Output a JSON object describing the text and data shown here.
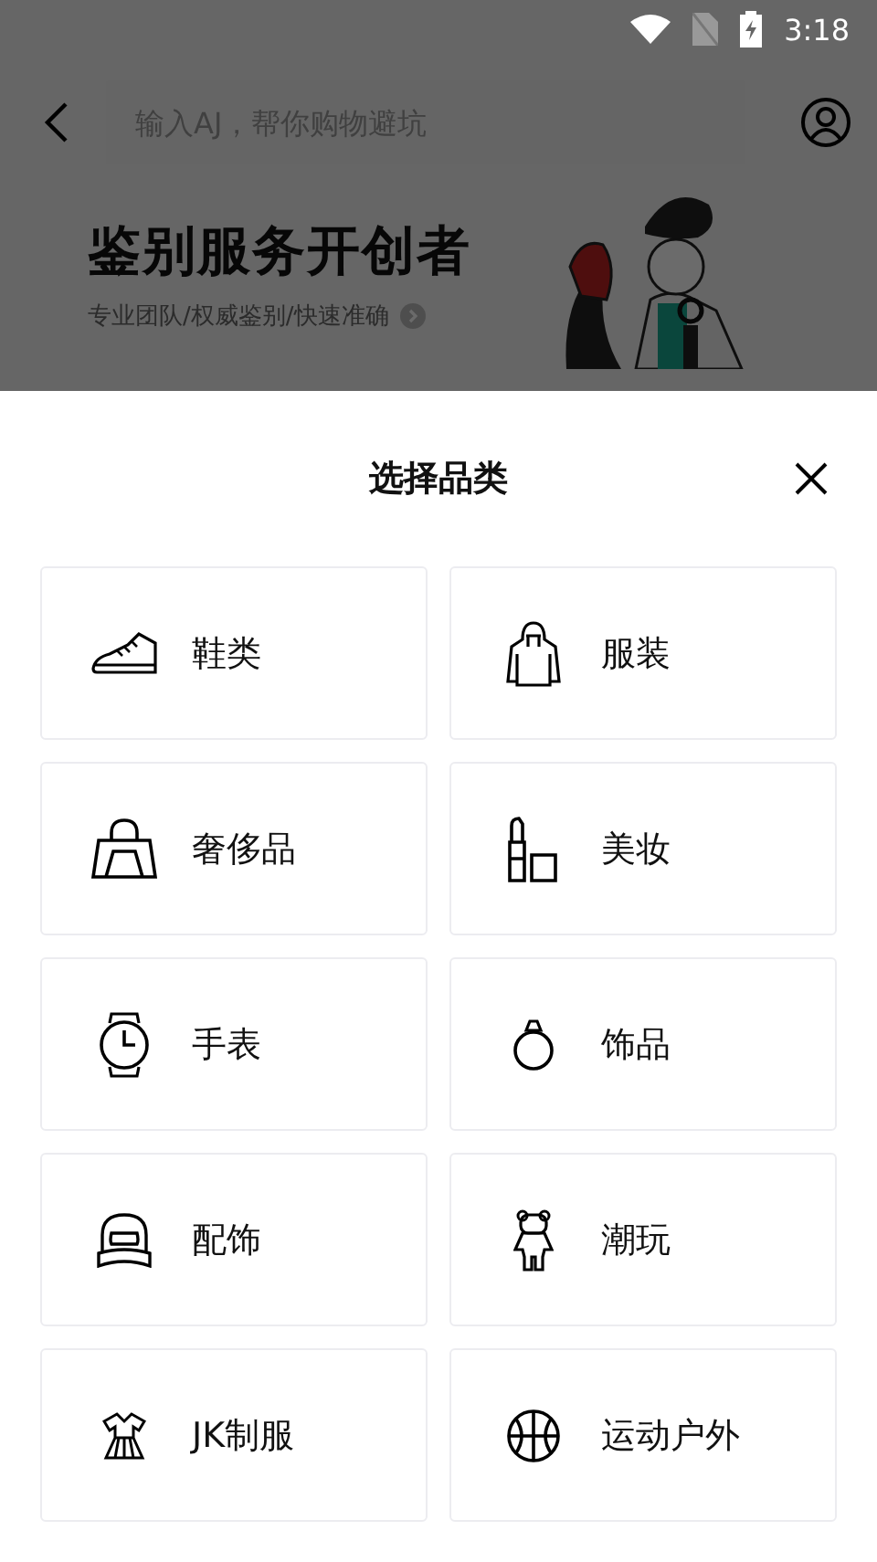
{
  "status_bar": {
    "time": "3:18"
  },
  "search": {
    "placeholder": "输入AJ，帮你购物避坑"
  },
  "banner": {
    "title": "鉴别服务开创者",
    "subtitle": "专业团队/权威鉴别/快速准确"
  },
  "sheet": {
    "title": "选择品类"
  },
  "categories": [
    {
      "kind": "shoe",
      "label": "鞋类"
    },
    {
      "kind": "hoodie",
      "label": "服装"
    },
    {
      "kind": "bag",
      "label": "奢侈品"
    },
    {
      "kind": "lipstick",
      "label": "美妆"
    },
    {
      "kind": "watch",
      "label": "手表"
    },
    {
      "kind": "ring",
      "label": "饰品"
    },
    {
      "kind": "cap",
      "label": "配饰"
    },
    {
      "kind": "bear",
      "label": "潮玩"
    },
    {
      "kind": "dress",
      "label": "JK制服"
    },
    {
      "kind": "ball",
      "label": "运动户外"
    }
  ]
}
